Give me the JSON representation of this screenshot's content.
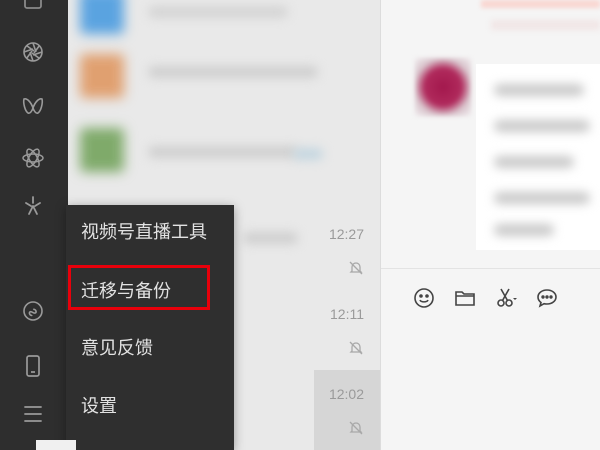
{
  "sidebar": {
    "icons": [
      "top-partial-icon",
      "aperture-icon",
      "butterfly-icon",
      "atom-icon",
      "sparkle-icon",
      "mini-program-icon",
      "phone-icon",
      "menu-icon"
    ]
  },
  "chat_list": {
    "times": [
      "12:27",
      "12:11",
      "12:02"
    ]
  },
  "popup_menu": {
    "items": [
      {
        "label": "视频号直播工具"
      },
      {
        "label": "迁移与备份"
      },
      {
        "label": "意见反馈"
      },
      {
        "label": "设置"
      }
    ]
  },
  "toolbar": {
    "icons": [
      "emoji-icon",
      "folder-icon",
      "scissors-icon",
      "chat-bubble-icon"
    ]
  },
  "colors": {
    "sidebar_bg": "#2e2e2e",
    "menu_bg": "#2f2f2f",
    "highlight": "#e8000b",
    "chat_list_bg": "#e9e9e9",
    "chat_area_bg": "#f5f5f5"
  }
}
